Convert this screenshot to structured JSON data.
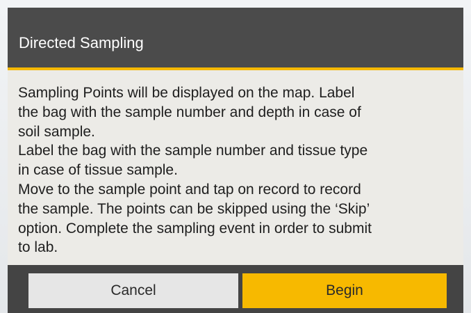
{
  "dialog": {
    "title": "Directed Sampling",
    "message_lines": [
      "Sampling Points will be displayed on the map. Label",
      "the bag with the sample number and depth in case of",
      "soil sample.",
      "Label the bag with the sample number and tissue type",
      "in case of tissue sample.",
      "Move to the sample point and tap on record to record",
      "the sample. The points can be skipped using the ‘Skip’",
      "option. Complete the sampling event in order to submit",
      "to lab."
    ],
    "cancel_label": "Cancel",
    "begin_label": "Begin"
  },
  "colors": {
    "header_background": "#4b4b4b",
    "accent": "#f5b800",
    "body_background": "#ecebe7",
    "cancel_button": "#e6e6e6",
    "begin_button": "#f7b900"
  }
}
